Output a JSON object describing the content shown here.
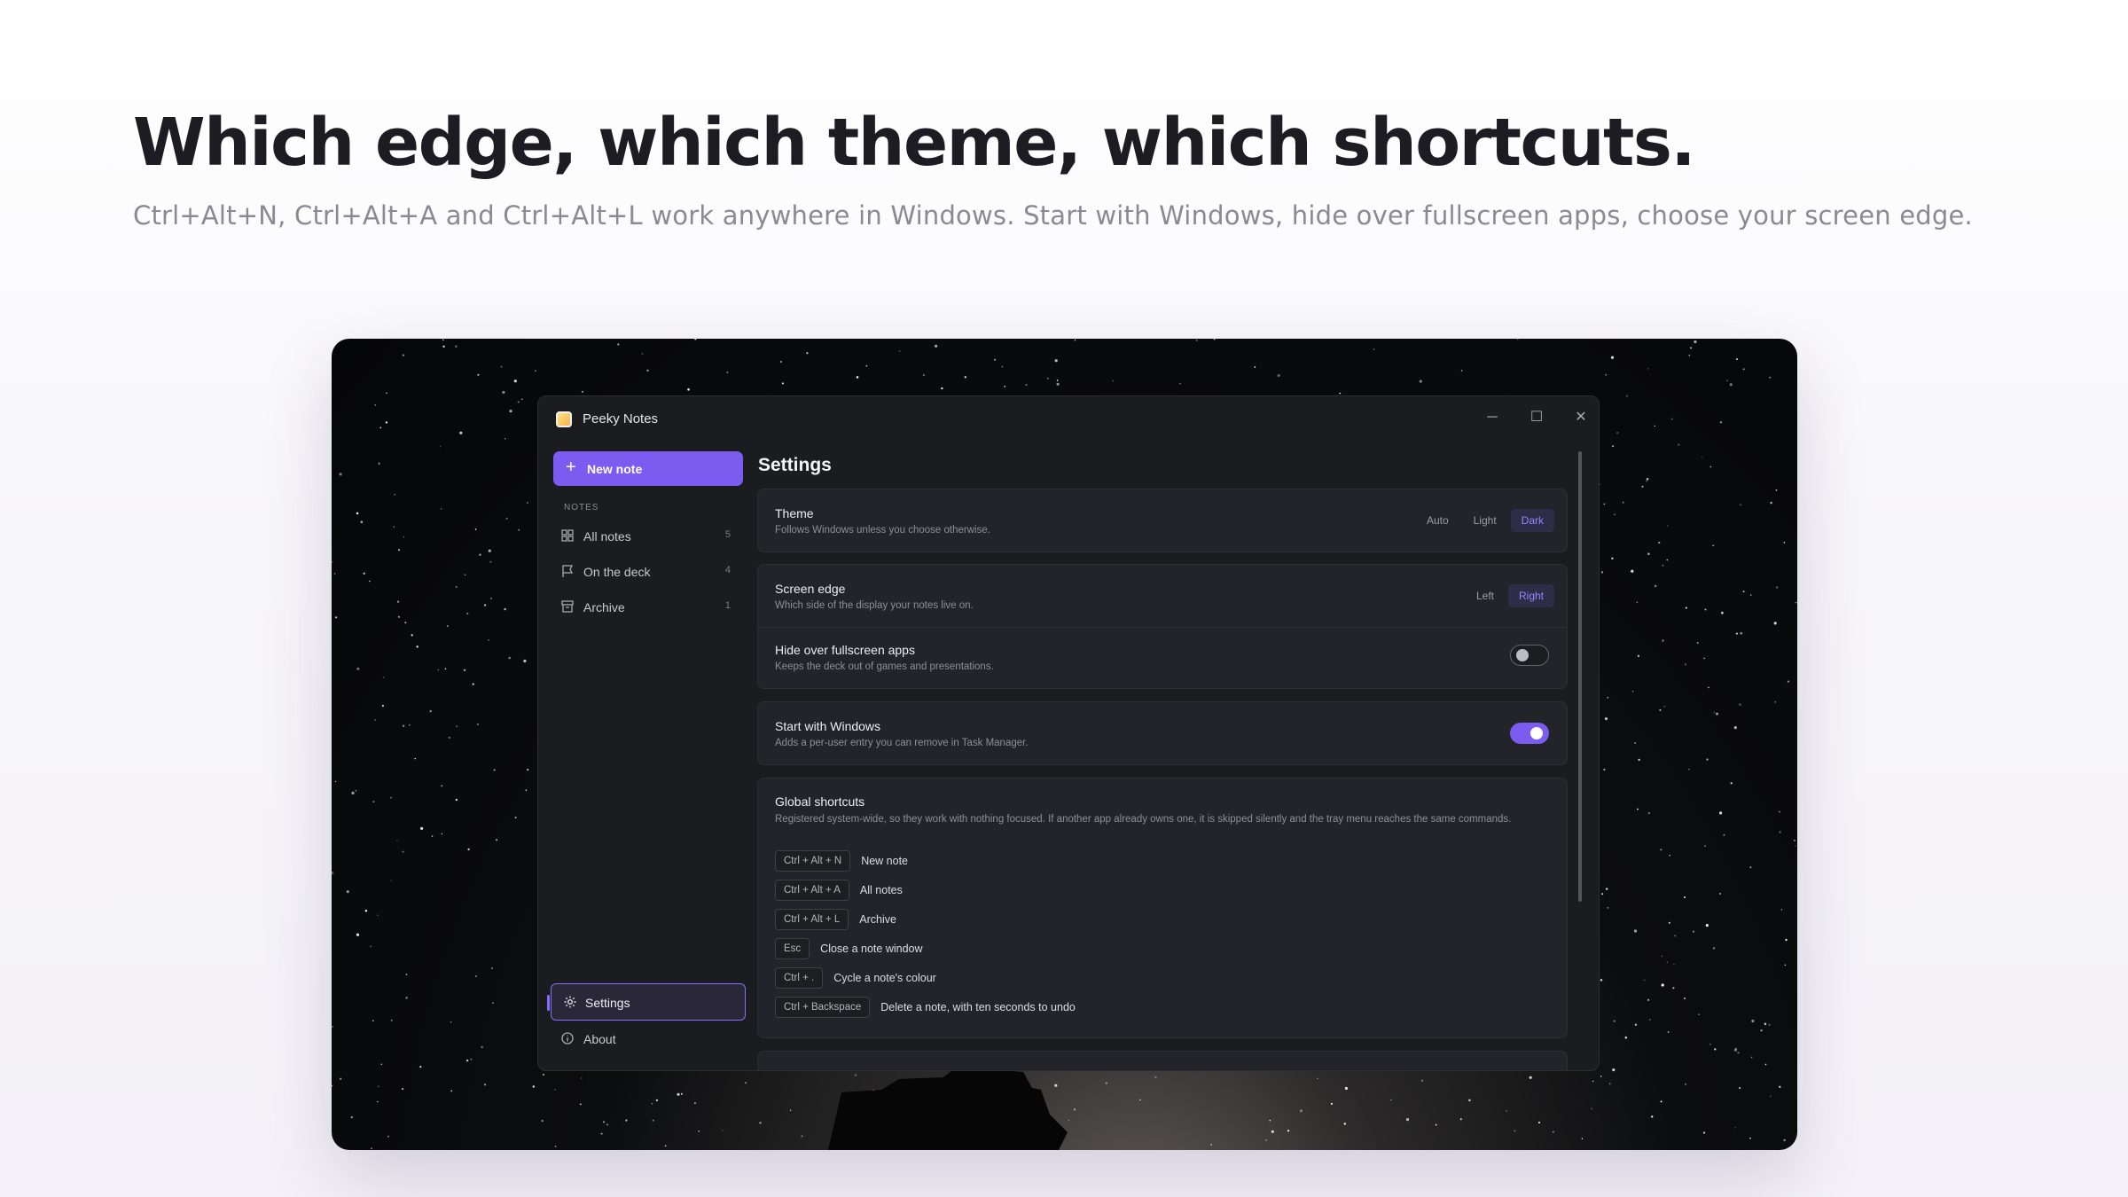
{
  "hero": {
    "title": "Which edge, which theme, which shortcuts.",
    "subtitle": "Ctrl+Alt+N, Ctrl+Alt+A and Ctrl+Alt+L work anywhere in Windows. Start with Windows, hide over fullscreen apps, choose your screen edge."
  },
  "window": {
    "title": "Peeky Notes",
    "controls": {
      "minimize": "─",
      "maximize": "☐",
      "close": "✕"
    }
  },
  "sidebar": {
    "new_note_label": "New note",
    "new_note_icon": "+",
    "section_label": "NOTES",
    "items": [
      {
        "label": "All notes",
        "count": "5",
        "icon": "grid-icon"
      },
      {
        "label": "On the deck",
        "count": "4",
        "icon": "flag-icon"
      },
      {
        "label": "Archive",
        "count": "1",
        "icon": "archive-icon"
      }
    ],
    "settings_label": "Settings",
    "about_label": "About"
  },
  "settings": {
    "title": "Settings",
    "theme": {
      "title": "Theme",
      "desc": "Follows Windows unless you choose otherwise.",
      "options": [
        "Auto",
        "Light",
        "Dark"
      ],
      "selected": "Dark"
    },
    "screen_edge": {
      "title": "Screen edge",
      "desc": "Which side of the display your notes live on.",
      "options": [
        "Left",
        "Right"
      ],
      "selected": "Right"
    },
    "hide_fullscreen": {
      "title": "Hide over fullscreen apps",
      "desc": "Keeps the deck out of games and presentations.",
      "enabled": false
    },
    "start_windows": {
      "title": "Start with Windows",
      "desc": "Adds a per-user entry you can remove in Task Manager.",
      "enabled": true
    },
    "shortcuts": {
      "title": "Global shortcuts",
      "desc": "Registered system-wide, so they work with nothing focused. If another app already owns one, it is skipped silently and the tray menu reaches the same commands.",
      "items": [
        {
          "keys": "Ctrl + Alt + N",
          "action": "New note"
        },
        {
          "keys": "Ctrl + Alt + A",
          "action": "All notes"
        },
        {
          "keys": "Ctrl + Alt + L",
          "action": "Archive"
        },
        {
          "keys": "Esc",
          "action": "Close a note window"
        },
        {
          "keys": "Ctrl + .",
          "action": "Cycle a note's colour"
        },
        {
          "keys": "Ctrl + Backspace",
          "action": "Delete a note, with ten seconds to undo"
        }
      ]
    }
  },
  "colors": {
    "accent": "#7c5cf0",
    "accent_text": "#9a82ff",
    "window_bg": "#1b1c20",
    "card_bg": "#232429"
  }
}
